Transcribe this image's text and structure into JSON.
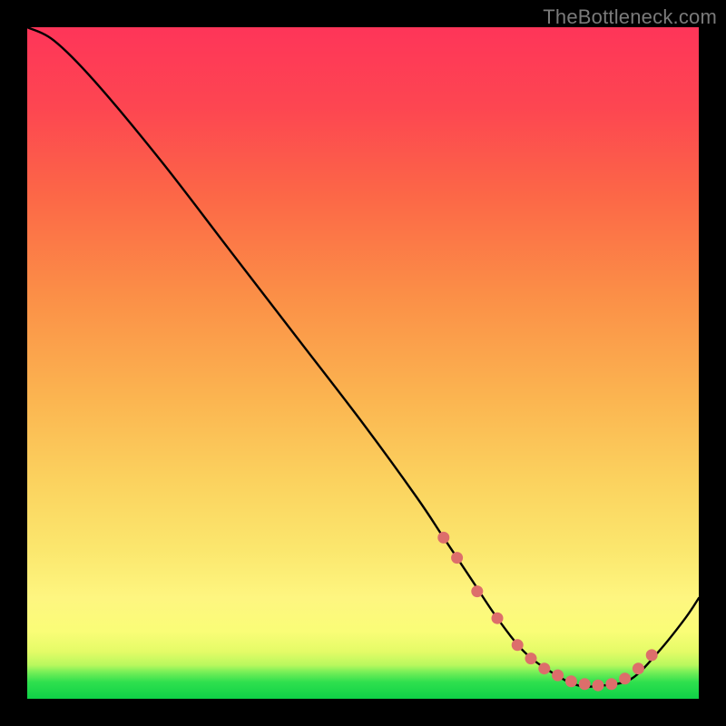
{
  "watermark": "TheBottleneck.com",
  "chart_data": {
    "type": "line",
    "title": "",
    "xlabel": "",
    "ylabel": "",
    "xlim": [
      0,
      100
    ],
    "ylim": [
      0,
      100
    ],
    "series": [
      {
        "name": "bottleneck-curve",
        "x": [
          0,
          4,
          10,
          20,
          30,
          40,
          50,
          58,
          62,
          66,
          70,
          74,
          78,
          82,
          86,
          90,
          94,
          98,
          100
        ],
        "y": [
          100,
          98,
          92,
          80,
          67,
          54,
          41,
          30,
          24,
          18,
          12,
          7,
          4,
          2,
          2,
          3,
          7,
          12,
          15
        ]
      }
    ],
    "markers": {
      "name": "highlight-points",
      "color": "#dd6e6b",
      "x": [
        62,
        64,
        67,
        70,
        73,
        75,
        77,
        79,
        81,
        83,
        85,
        87,
        89,
        91,
        93
      ],
      "y": [
        24,
        21,
        16,
        12,
        8,
        6,
        4.5,
        3.5,
        2.6,
        2.2,
        2.0,
        2.2,
        3.0,
        4.5,
        6.5
      ]
    }
  }
}
